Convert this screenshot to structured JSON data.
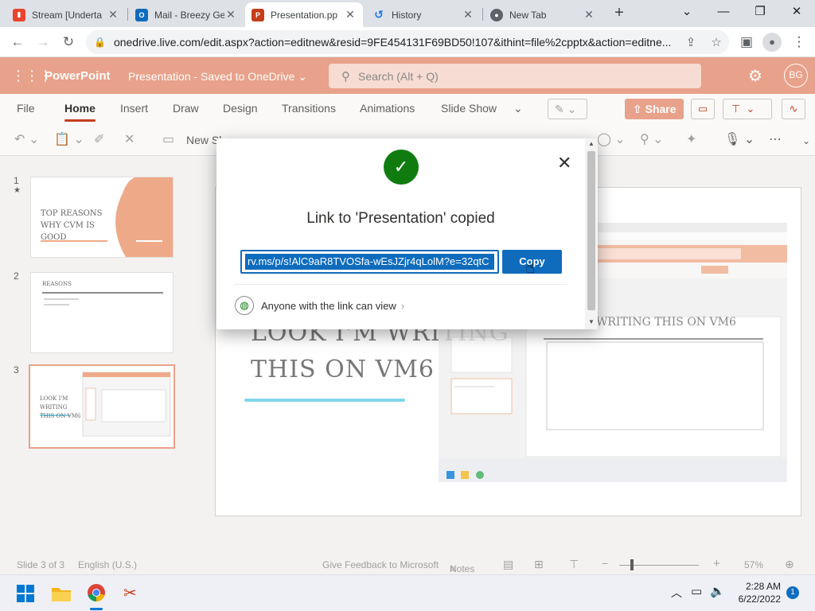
{
  "browser": {
    "tabs": [
      {
        "label": "Stream [Underta",
        "icon": "stream-icon",
        "color": "#e8442e"
      },
      {
        "label": "Mail - Breezy Ge",
        "icon": "outlook-icon",
        "color": "#0f6cbd"
      },
      {
        "label": "Presentation.pp",
        "icon": "powerpoint-icon",
        "color": "#c43e1c"
      },
      {
        "label": "History",
        "icon": "history-icon",
        "color": "#1a73e8"
      },
      {
        "label": "New Tab",
        "icon": "chrome-icon",
        "color": "#5f6368"
      }
    ],
    "url": "onedrive.live.com/edit.aspx?action=editnew&resid=9FE454131F69BD50!107&ithint=file%2cpptx&action=editne..."
  },
  "app": {
    "name": "PowerPoint",
    "doc_title": "Presentation  -  Saved to OneDrive",
    "search_placeholder": "Search (Alt + Q)",
    "user_initials": "BG",
    "accent": "#e8a18a"
  },
  "ribbon": {
    "tabs": [
      "File",
      "Home",
      "Insert",
      "Draw",
      "Design",
      "Transitions",
      "Animations",
      "Slide Show"
    ],
    "active_tab": "Home",
    "share_label": "Share",
    "new_slide_label": "New Sl"
  },
  "thumbnails": [
    {
      "num": "1",
      "title": "TOP REASONS WHY CVM IS GOOD"
    },
    {
      "num": "2",
      "title": "REASONS"
    },
    {
      "num": "3",
      "title": "LOOK I'M WRITING THIS ON VM6"
    }
  ],
  "slide": {
    "title_line1": "LOOK I'M WRITING",
    "title_line2": "THIS ON VM6",
    "embedded_heading": "WRITING THIS ON VM6"
  },
  "dialog": {
    "title": "Link to 'Presentation' copied",
    "link": "rv.ms/p/s!AlC9aR8TVOSfa-wEsJZjr4qLolM?e=32qtC",
    "copy_label": "Copy",
    "permission": "Anyone with the link can view"
  },
  "status": {
    "slide_info": "Slide 3 of 3",
    "language": "English (U.S.)",
    "feedback": "Give Feedback to Microsoft",
    "notes": "Notes",
    "zoom": "57%"
  },
  "taskbar": {
    "time": "2:28 AM",
    "date": "6/22/2022",
    "badge": "1"
  }
}
